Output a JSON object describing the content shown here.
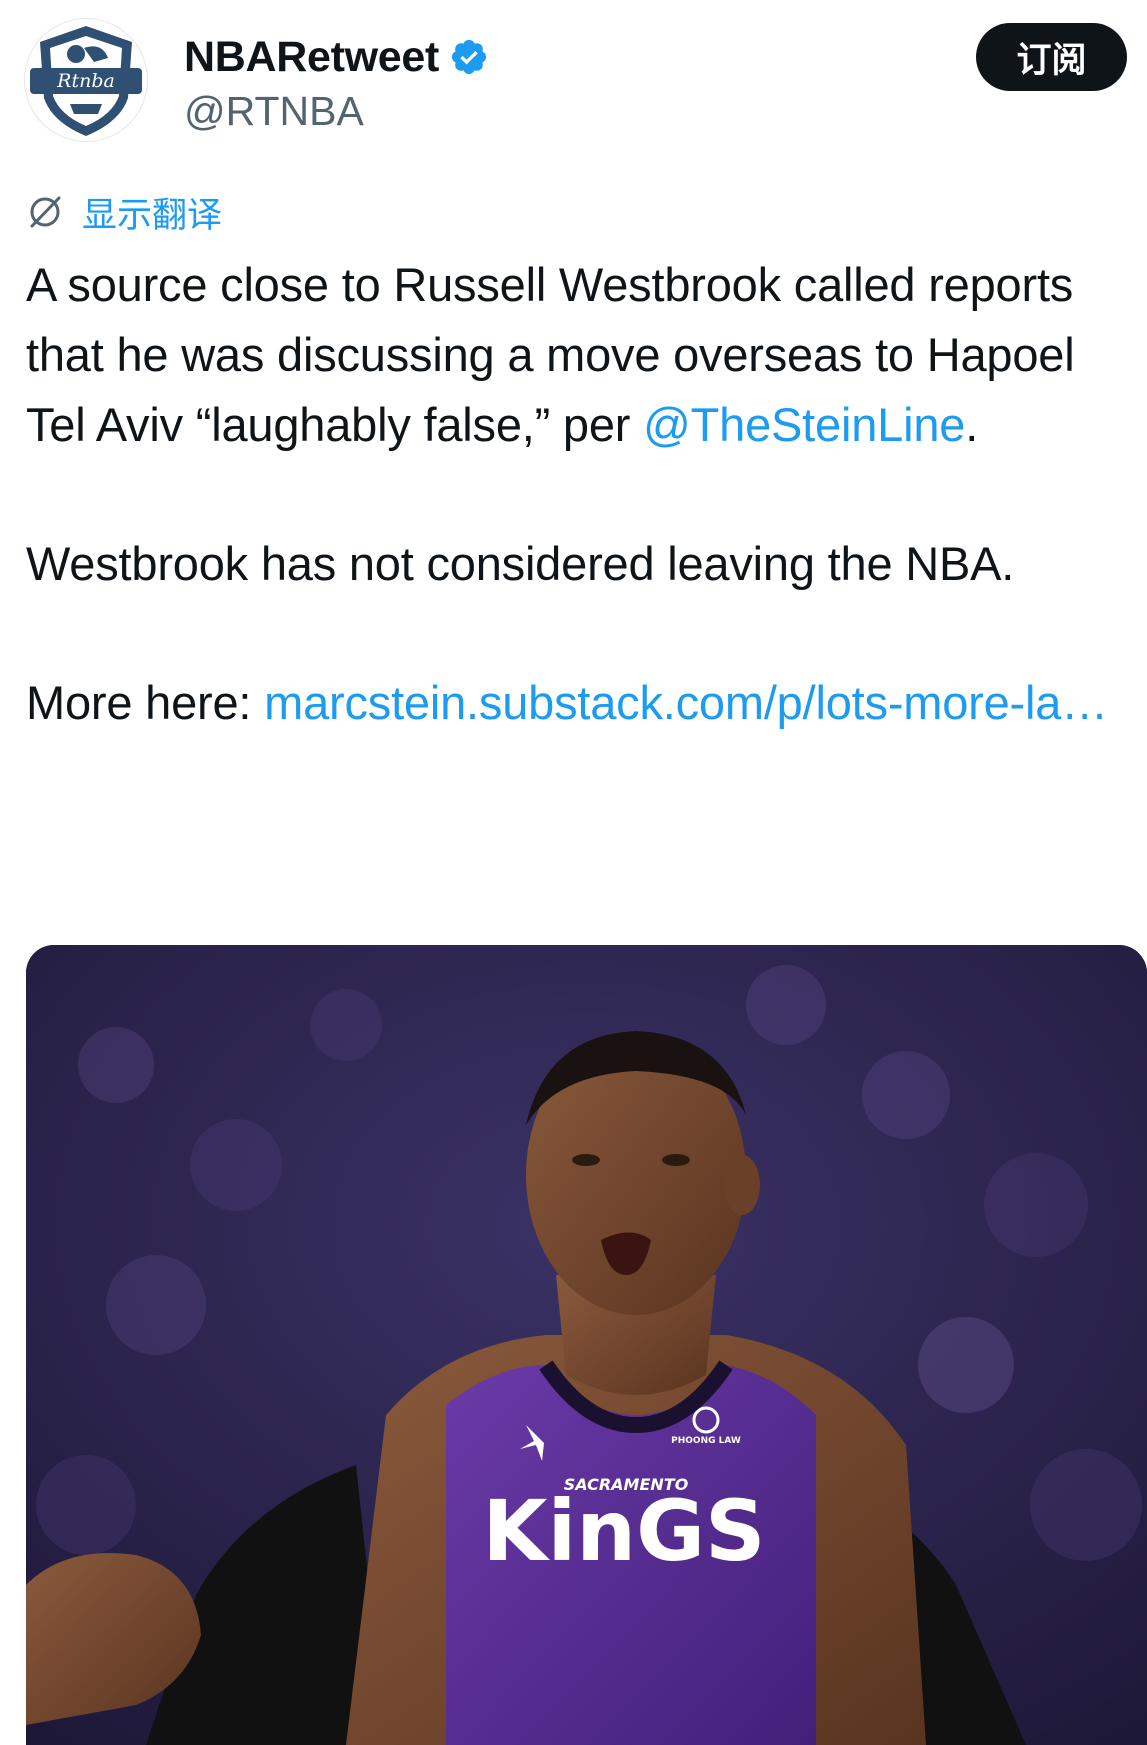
{
  "author": {
    "display_name": "NBARetweet",
    "handle": "@RTNBA",
    "avatar_text": "Rtnba",
    "verified": true
  },
  "actions": {
    "subscribe_label": "订阅"
  },
  "translate": {
    "label": "显示翻译",
    "icon": "translate-globe-icon"
  },
  "tweet": {
    "p1_text": "A source close to Russell Westbrook called reports that he was discussing a move overseas to Hapoel Tel Aviv “laughably false,” per ",
    "p1_mention": "@TheSteinLine",
    "p1_end": ".",
    "p2_text": "Westbrook has not considered leaving the NBA.",
    "p3_prefix": "More here: ",
    "p3_link": "marcstein.substack.com/p/lots-more-la…"
  },
  "media": {
    "jersey_team_small": "SACRAMENTO",
    "jersey_team_big": "KinGS",
    "sponsor": "PHOONG LAW",
    "accent_color": "#5a2d91",
    "background_color": "#2a2350"
  },
  "colors": {
    "link": "#1d9bf0",
    "text": "#0f1419",
    "secondary": "#536471",
    "verified": "#1d9bf0"
  }
}
